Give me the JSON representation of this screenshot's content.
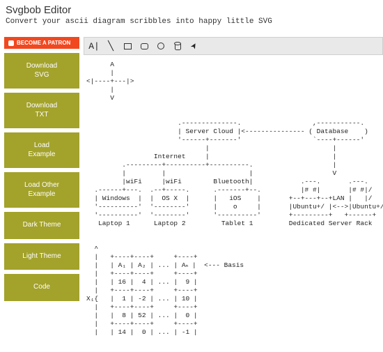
{
  "header": {
    "title": "Svgbob Editor",
    "subtitle": "Convert your ascii diagram scribbles into happy little SVG"
  },
  "sidebar": {
    "patron_label": "BECOME A PATRON",
    "buttons": [
      "Download\nSVG",
      "Download\nTXT",
      "Load\nExample",
      "Load Other\nExample",
      "Dark Theme",
      "Light Theme",
      "Code"
    ]
  },
  "toolbar": {
    "tools": [
      {
        "name": "text-tool-icon",
        "glyph": "A|"
      },
      {
        "name": "line-tool-icon",
        "glyph": "╲"
      },
      {
        "name": "rect-tool-icon",
        "glyph": "rect"
      },
      {
        "name": "rounded-rect-tool-icon",
        "glyph": "rrect"
      },
      {
        "name": "circle-tool-icon",
        "glyph": "circ"
      },
      {
        "name": "cylinder-tool-icon",
        "glyph": "cyl"
      },
      {
        "name": "pointer-tool-icon",
        "glyph": "➤"
      }
    ]
  },
  "canvas": {
    "ascii": "      A\n      |\n<|----+---|>\n      |\n      V\n\n\n                       .--------------.                  ,-----------.\n                       | Server Cloud |<--------------- ( Database    )\n                       '------+-------'                  `----+------'\n                              |                               |\n                 Internet     |                               |\n         .---------+----------+----------.                    |\n         |         |                     |                    V\n         |wiFi     |wiFi        Bluetooth|            .---.       .---.\n  .------+---.  .--+-----.      .-------+--.          |# #|       |# #|/\n  | Windows  |  |  OS X  |      |   iOS    |       +--+---+--+LAN |   |/\n  '----------'  '--------'      |    o     |       |Ubuntu+/ |<-->|Ubuntu+/\n  '----------'  '--------'      '----------'       +---------+   +------+\n   Laptop 1      Laptop 2         Tablet 1         Dedicated Server Rack\n\n\n  ^\n  |   +----+----+     +----+\n  |   | A₁ | A₂ | ... | Aₙ |  <--- Basis\n  |   +----+----+     +----+\n  |   | 16 |  4 | ... |  9 |\n  |   +----+----+     +----+\nX₁{   |  1 | -2 | ... | 10 |\n  |   +----+----+     +----+\n  |   |  8 | 52 | ... |  0 |\n  |   +----+----+     +----+\n  |   | 14 |  0 | ... | -1 |"
  }
}
